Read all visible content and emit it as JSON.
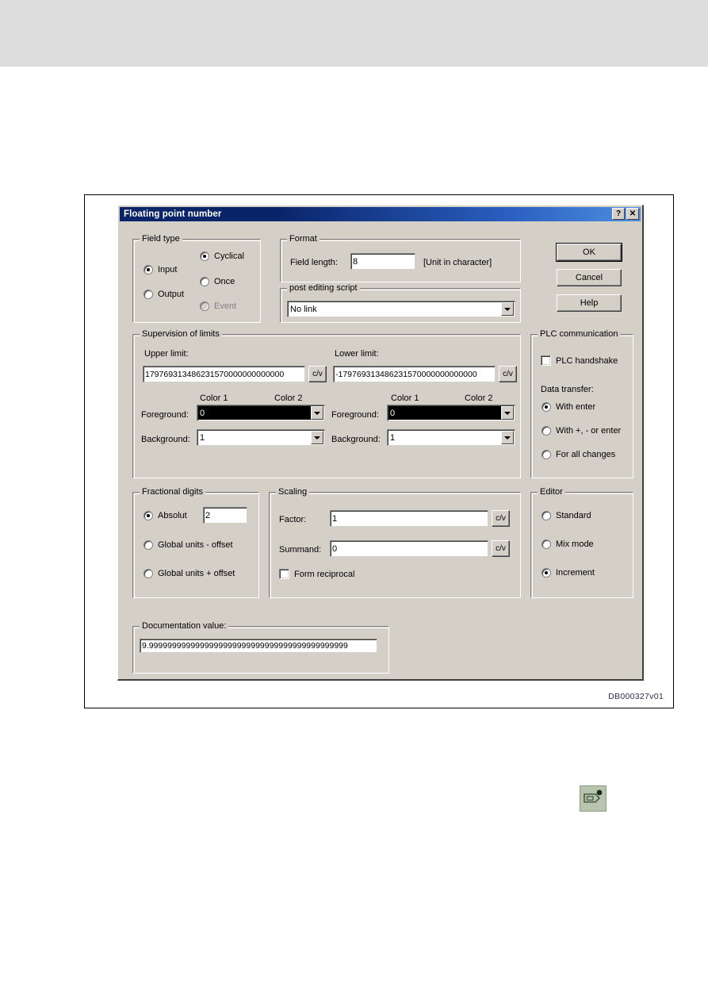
{
  "figure": {
    "caption": "DB000327v01"
  },
  "dialog": {
    "title": "Floating point number",
    "titlebar_buttons": [
      {
        "name": "help-button",
        "glyph": "?"
      },
      {
        "name": "close-button",
        "glyph": "✕"
      }
    ],
    "buttons": {
      "ok": "OK",
      "cancel": "Cancel",
      "help": "Help"
    },
    "field_type": {
      "title": "Field type",
      "options": [
        {
          "label": "Input",
          "selected": true,
          "disabled": false
        },
        {
          "label": "Output",
          "selected": false,
          "disabled": false
        }
      ],
      "modes": [
        {
          "label": "Cyclical",
          "selected": true,
          "disabled": false
        },
        {
          "label": "Once",
          "selected": false,
          "disabled": false
        },
        {
          "label": "Event",
          "selected": false,
          "disabled": true
        }
      ]
    },
    "format": {
      "title": "Format",
      "field_length_label": "Field length:",
      "field_length_value": "8",
      "unit_note": "[Unit in character]"
    },
    "post_editing_script": {
      "title": "post editing script",
      "value": "No link"
    },
    "supervision": {
      "title": "Supervision of limits",
      "upper_label": "Upper limit:",
      "upper_value": "179769313486231570000000000000",
      "lower_label": "Lower limit:",
      "lower_value": "-179769313486231570000000000000",
      "cv_label": "c/v",
      "color1_label": "Color 1",
      "color2_label": "Color 2",
      "foreground_label": "Foreground:",
      "background_label": "Background:",
      "upper_foreground_value": "0",
      "upper_background_value": "1",
      "lower_foreground_value": "0",
      "lower_background_value": "1"
    },
    "plc": {
      "title": "PLC communication",
      "handshake_label": "PLC handshake",
      "handshake_checked": false,
      "data_transfer_label": "Data transfer:",
      "options": [
        {
          "label": "With enter",
          "selected": true
        },
        {
          "label": "With +, - or enter",
          "selected": false
        },
        {
          "label": "For all changes",
          "selected": false
        }
      ]
    },
    "fractional": {
      "title": "Fractional digits",
      "options": [
        {
          "label": "Absolut",
          "selected": true
        },
        {
          "label": "Global units - offset",
          "selected": false
        },
        {
          "label": "Global units + offset",
          "selected": false
        }
      ],
      "absolut_value": "2"
    },
    "scaling": {
      "title": "Scaling",
      "factor_label": "Factor:",
      "factor_value": "1",
      "summand_label": "Summand:",
      "summand_value": "0",
      "cv_label": "c/v",
      "reciprocal_label": "Form reciprocal",
      "reciprocal_checked": false
    },
    "editor": {
      "title": "Editor",
      "options": [
        {
          "label": "Standard",
          "selected": false
        },
        {
          "label": "Mix mode",
          "selected": false
        },
        {
          "label": "Increment",
          "selected": true
        }
      ]
    },
    "documentation": {
      "title": "Documentation value:",
      "value": "9.9999999999999999999999999999999999999999999"
    }
  },
  "icon": {
    "name": "data-field-icon"
  }
}
